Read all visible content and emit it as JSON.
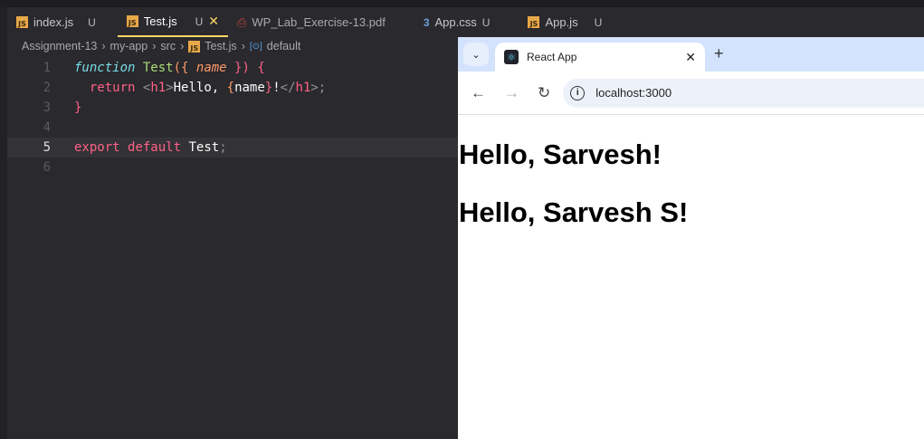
{
  "editor": {
    "tabs": [
      {
        "icon": "js-file-icon",
        "label": "index.js",
        "status": "U"
      },
      {
        "icon": "js-file-icon",
        "label": "Test.js",
        "status": "U",
        "active": true
      },
      {
        "icon": "pdf-file-icon",
        "label": "WP_Lab_Exercise-13.pdf"
      },
      {
        "icon": "css-file-icon",
        "label": "App.css",
        "status": "U"
      },
      {
        "icon": "js-file-icon",
        "label": "App.js",
        "status": "U"
      }
    ],
    "breadcrumb": [
      "Assignment-13",
      "my-app",
      "src",
      "Test.js",
      "default"
    ],
    "line_numbers": [
      "1",
      "2",
      "3",
      "4",
      "5",
      "6"
    ],
    "current_line": 5
  },
  "browser": {
    "tab_title": "React App",
    "url": "localhost:3000",
    "headings": [
      "Hello, Sarvesh!",
      "Hello, Sarvesh S!"
    ]
  },
  "colors": {
    "accent": "#ffd866",
    "editor_bg": "#2a292d",
    "browser_tabstrip": "#d3e3fd"
  }
}
